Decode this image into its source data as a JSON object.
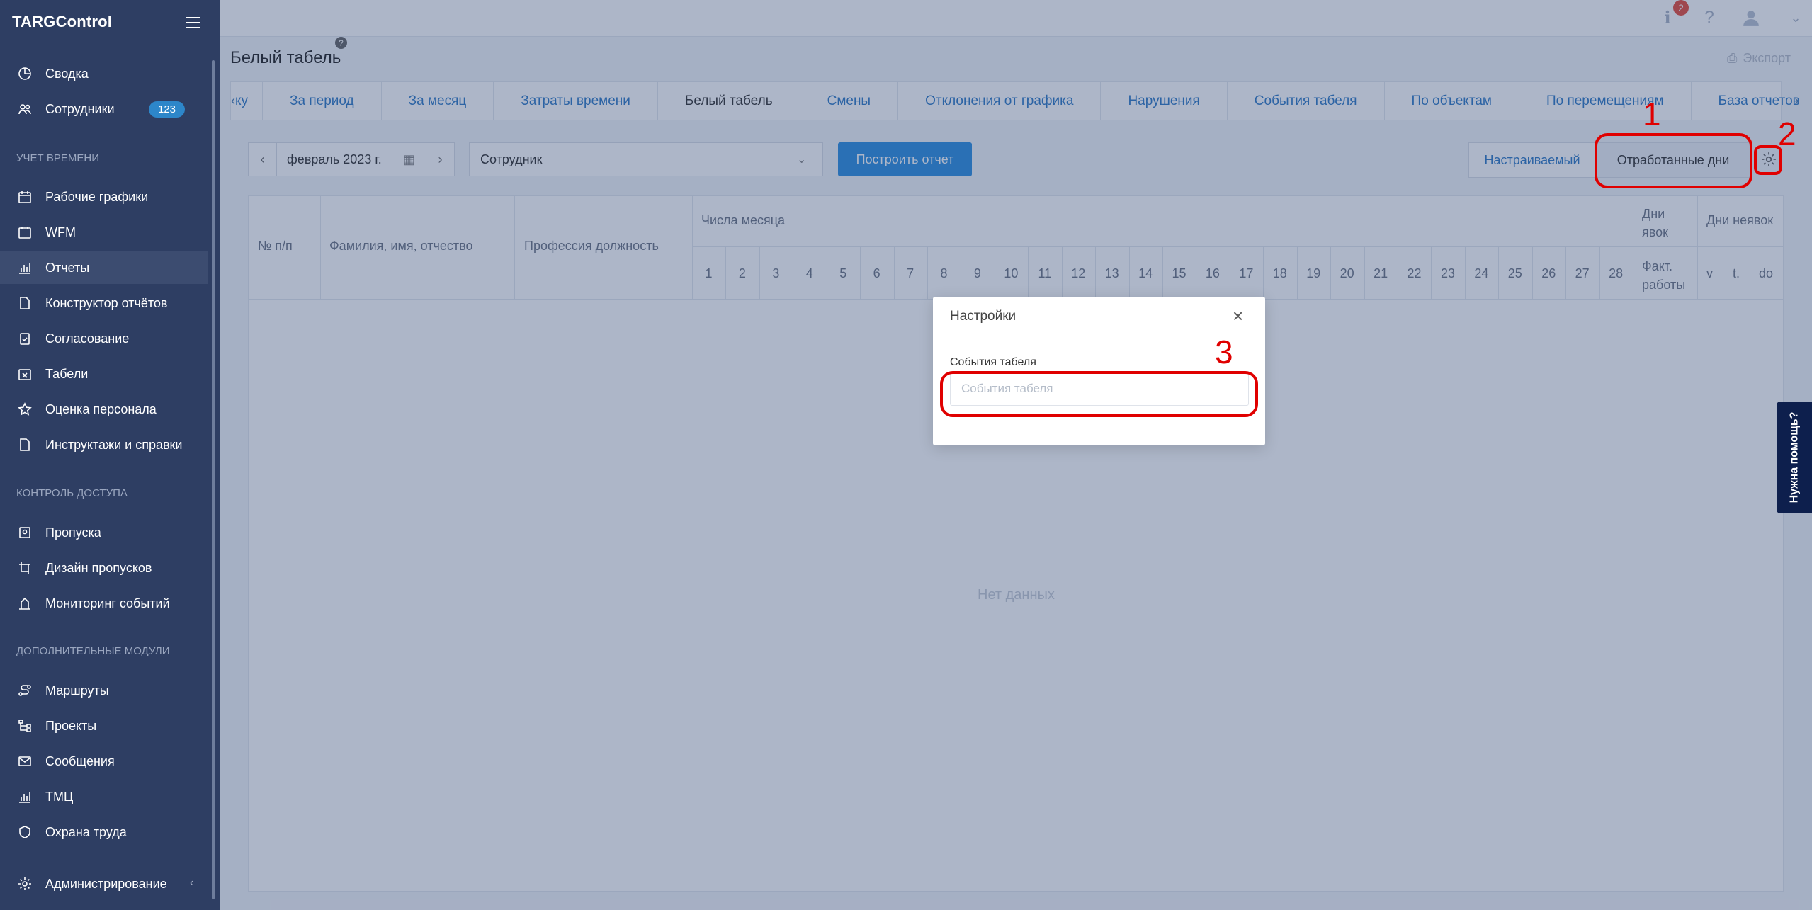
{
  "app": {
    "brand": "TARGControl"
  },
  "sidebar": {
    "items": [
      {
        "label": "Сводка",
        "icon": "pie-chart-icon"
      },
      {
        "label": "Сотрудники",
        "icon": "users-icon",
        "badge": "123"
      },
      {
        "label": "Рабочие графики",
        "icon": "calendar-icon"
      },
      {
        "label": "WFM",
        "icon": "calendar-check-icon"
      },
      {
        "label": "Отчеты",
        "icon": "bar-chart-icon",
        "active": true
      },
      {
        "label": "Конструктор отчётов",
        "icon": "document-icon"
      },
      {
        "label": "Согласование",
        "icon": "clipboard-check-icon"
      },
      {
        "label": "Табели",
        "icon": "calendar-x-icon"
      },
      {
        "label": "Оценка персонала",
        "icon": "star-icon"
      },
      {
        "label": "Инструктажи и справки",
        "icon": "file-icon"
      },
      {
        "label": "Пропуска",
        "icon": "badge-icon"
      },
      {
        "label": "Дизайн пропусков",
        "icon": "design-icon"
      },
      {
        "label": "Мониторинг событий",
        "icon": "monitor-icon"
      },
      {
        "label": "Маршруты",
        "icon": "route-icon"
      },
      {
        "label": "Проекты",
        "icon": "tree-icon"
      },
      {
        "label": "Сообщения",
        "icon": "mail-icon"
      },
      {
        "label": "ТМЦ",
        "icon": "chart-icon"
      },
      {
        "label": "Охрана труда",
        "icon": "shield-icon"
      },
      {
        "label": "Администрирование",
        "icon": "gear-icon"
      }
    ],
    "sections": {
      "time": "Учет времени",
      "access": "Контроль доступа",
      "modules": "Дополнительные модули"
    }
  },
  "topbar": {
    "notify_count": "2"
  },
  "page": {
    "title": "Белый табель",
    "help": "?",
    "export_label": "Экспорт"
  },
  "tabs": [
    {
      "label": "ку",
      "active": false
    },
    {
      "label": "За период",
      "active": false
    },
    {
      "label": "За месяц",
      "active": false
    },
    {
      "label": "Затраты времени",
      "active": false
    },
    {
      "label": "Белый табель",
      "active": true
    },
    {
      "label": "Смены",
      "active": false
    },
    {
      "label": "Отклонения от графика",
      "active": false
    },
    {
      "label": "Нарушения",
      "active": false
    },
    {
      "label": "События табеля",
      "active": false
    },
    {
      "label": "По объектам",
      "active": false
    },
    {
      "label": "По перемещениям",
      "active": false
    },
    {
      "label": "База отчетов",
      "active": false
    }
  ],
  "toolbar": {
    "month_value": "февраль 2023 г.",
    "employee_placeholder": "Сотрудник",
    "build_label": "Построить отчет",
    "custom_label": "Настраиваемый",
    "worked_days_label": "Отработанные дни"
  },
  "table": {
    "headers": {
      "num": "№ п/п",
      "fio": "Фамилия, имя, отчество",
      "profession": "Профессия должность",
      "days_of_month": "Числа месяца",
      "attendance_days": "Дни явок",
      "actual_work": "Факт. работы",
      "absence_days": "Дни неявок",
      "abs_v": "v",
      "abs_t": "t.",
      "abs_do": "do"
    },
    "days": [
      "1",
      "2",
      "3",
      "4",
      "5",
      "6",
      "7",
      "8",
      "9",
      "10",
      "11",
      "12",
      "13",
      "14",
      "15",
      "16",
      "17",
      "18",
      "19",
      "20",
      "21",
      "22",
      "23",
      "24",
      "25",
      "26",
      "27",
      "28"
    ],
    "empty": "Нет данных"
  },
  "modal": {
    "title": "Настройки",
    "field_label": "События табеля",
    "field_placeholder": "События табеля"
  },
  "annotations": {
    "one": "1",
    "two": "2",
    "three": "3"
  },
  "help_tab": "Нужна помощь?",
  "colors": {
    "sidebar_bg": "#2e3e63",
    "primary": "#2d8fe0",
    "link": "#2f7ac6",
    "annotation": "#e00000"
  }
}
